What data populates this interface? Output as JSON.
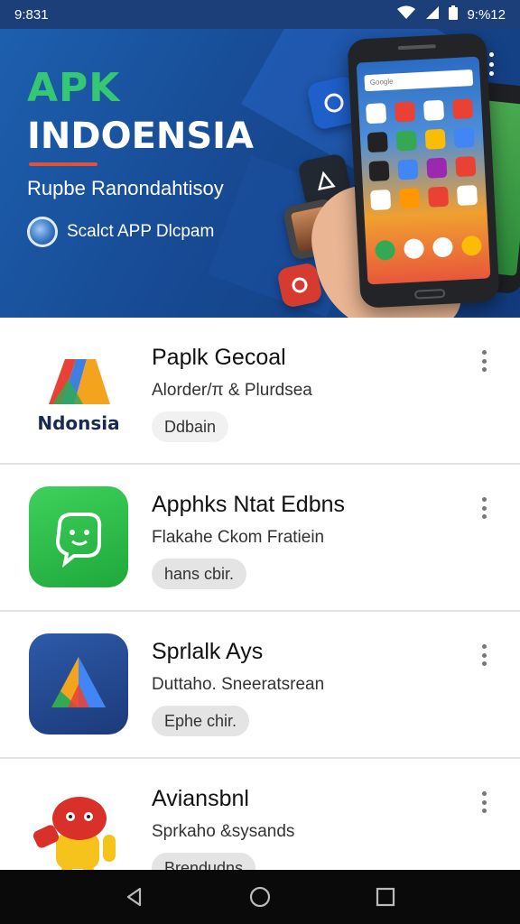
{
  "status_bar": {
    "time": "9:831",
    "right_text": "9:%12",
    "icons": [
      "wifi-icon",
      "signal-icon",
      "battery-icon"
    ]
  },
  "hero": {
    "title_line1": "APK",
    "title_line2": "INDOENSIA",
    "subtitle": "Rupbe Ranondahtisoy",
    "badge_text": "Scalct APP Dlcpam",
    "accent_green": "#34c774",
    "accent_red": "#e0533a",
    "background": "#174a93",
    "phone_search_text": "Google"
  },
  "apps": [
    {
      "name": "Paplk Gecoal",
      "description": "Alorder/π & Plurdsea",
      "chip": "Ddbain",
      "icon": "ndonesia-logo-icon",
      "icon_text": "Ndonsia"
    },
    {
      "name": "Apphks Ntat Edbns",
      "description": "Flakahe Ckom Fratiein",
      "chip": "hans cbir.",
      "icon": "green-robot-icon"
    },
    {
      "name": "Sprlalk Ays",
      "description": "Duttaho. Sneeratsrean",
      "chip": "Ephe chir.",
      "icon": "triangle-logo-icon"
    },
    {
      "name": "Aviansbnl",
      "description": "Sprkaho &sysands",
      "chip": "Brendudns",
      "icon": "red-robot-mascot-icon"
    }
  ],
  "nav_bar": {
    "icons": [
      "back-icon",
      "home-icon",
      "recents-icon"
    ]
  }
}
